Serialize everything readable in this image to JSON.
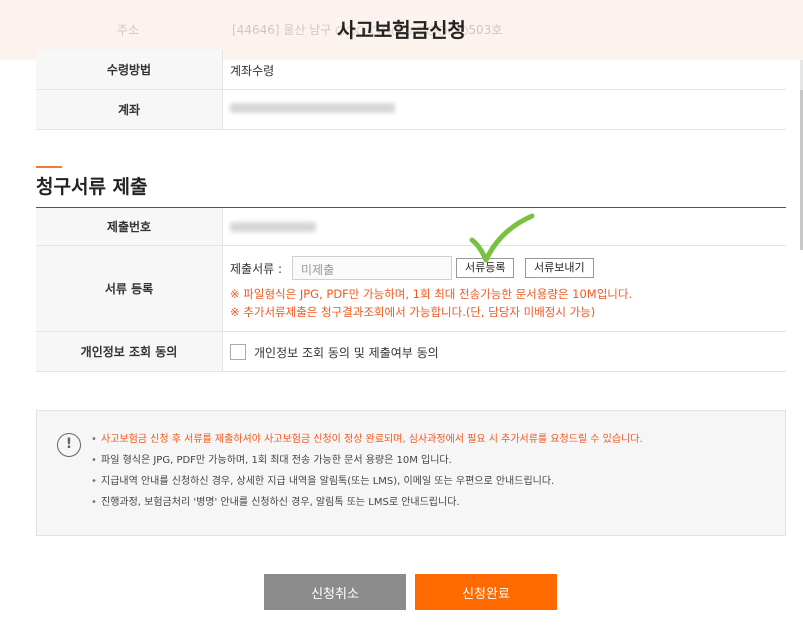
{
  "header": {
    "title": "사고보험금신청",
    "faded_label": "주소",
    "faded_value": "[44646] 울산 남구 ○○○ ○○○○ ○○○○○503호"
  },
  "info_rows": [
    {
      "label": "수령방법",
      "value": "계좌수령"
    },
    {
      "label": "계좌",
      "value": ""
    }
  ],
  "section": {
    "title": "청구서류 제출"
  },
  "doc_rows": {
    "submit_no_label": "제출번호",
    "register_label": "서류 등록",
    "file_label": "제출서류 :",
    "file_placeholder": "미제출",
    "upload_button": "서류등록",
    "send_button": "서류보내기",
    "warning_1": "※ 파일형식은 JPG, PDF만 가능하며, 1회 최대 전송가능한 문서용량은 10M입니다.",
    "warning_2": "※ 추가서류제출은 청구결과조회에서 가능합니다.(단, 담당자 미배정시 가능)",
    "consent_label": "개인정보 조회 동의",
    "consent_checkbox_label": "개인정보 조회 동의 및 제출여부 동의"
  },
  "notice": {
    "icon": "exclamation-icon",
    "items": [
      "사고보험금 신청 후 서류를 제출하셔야 사고보험금 신청이 정상 완료되며, 심사과정에서 필요 시 추가서류를 요청드릴 수 있습니다.",
      "파일 형식은 JPG, PDF만 가능하며, 1회 최대 전송 가능한 문서 용량은 10M 입니다.",
      "지급내역 안내를 신청하신 경우, 상세한 지급 내역을 알림톡(또는 LMS), 이메일 또는 우편으로 안내드립니다.",
      "진행과정, 보험금처리 '병명' 안내를 신청하신 경우, 알림톡 또는 LMS로 안내드립니다."
    ]
  },
  "actions": {
    "cancel": "신청취소",
    "submit": "신청완료"
  },
  "colors": {
    "accent": "#ff6a00",
    "warning_text": "#f0591e",
    "cancel_bg": "#8c8c8c",
    "check_annotation": "#7ac142"
  }
}
